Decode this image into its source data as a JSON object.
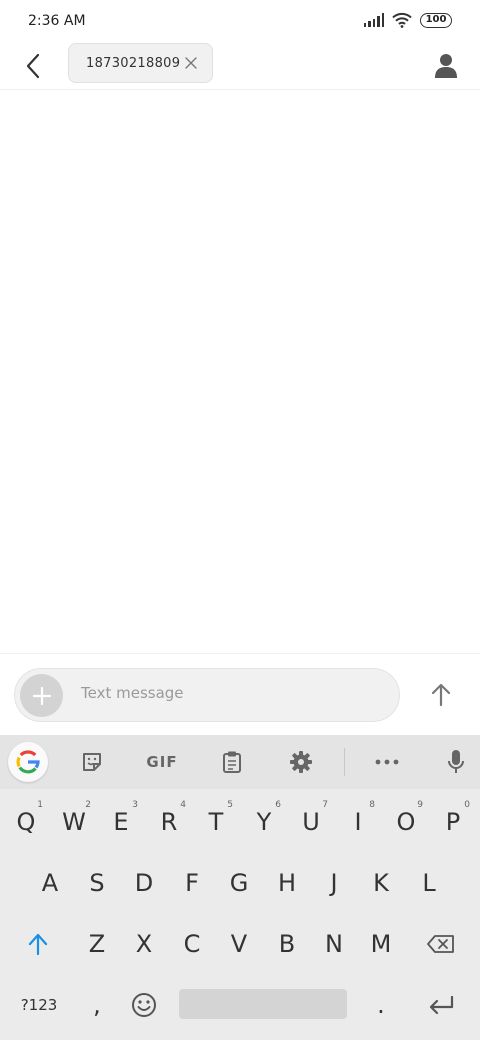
{
  "status_bar": {
    "time": "2:36 AM",
    "battery": "100",
    "icons": [
      "signal-icon",
      "wifi-icon",
      "battery-icon"
    ]
  },
  "header": {
    "back_icon": "chevron-left-icon",
    "recipient": "18730218809",
    "remove_icon": "close-icon",
    "contact_icon": "person-icon"
  },
  "compose": {
    "placeholder": "Text message",
    "attach_icon": "plus-icon",
    "send_icon": "arrow-up-icon"
  },
  "keyboard": {
    "toolbar": {
      "google_icon": "google-g-icon",
      "sticker_icon": "sticker-icon",
      "gif_label": "GIF",
      "clipboard_icon": "clipboard-icon",
      "settings_icon": "gear-icon",
      "more_icon": "more-horizontal-icon",
      "mic_icon": "microphone-icon"
    },
    "row1": [
      {
        "k": "Q",
        "h": "1"
      },
      {
        "k": "W",
        "h": "2"
      },
      {
        "k": "E",
        "h": "3"
      },
      {
        "k": "R",
        "h": "4"
      },
      {
        "k": "T",
        "h": "5"
      },
      {
        "k": "Y",
        "h": "6"
      },
      {
        "k": "U",
        "h": "7"
      },
      {
        "k": "I",
        "h": "8"
      },
      {
        "k": "O",
        "h": "9"
      },
      {
        "k": "P",
        "h": "0"
      }
    ],
    "row2": [
      "A",
      "S",
      "D",
      "F",
      "G",
      "H",
      "J",
      "K",
      "L"
    ],
    "row3": [
      "Z",
      "X",
      "C",
      "V",
      "B",
      "N",
      "M"
    ],
    "shift_icon": "shift-arrow-icon",
    "backspace_icon": "backspace-icon",
    "symbols_label": "?123",
    "comma_label": ",",
    "emoji_icon": "emoji-icon",
    "period_label": ".",
    "enter_icon": "enter-icon",
    "colors": {
      "accent": "#1a8fe3",
      "key_text": "#333333"
    }
  }
}
